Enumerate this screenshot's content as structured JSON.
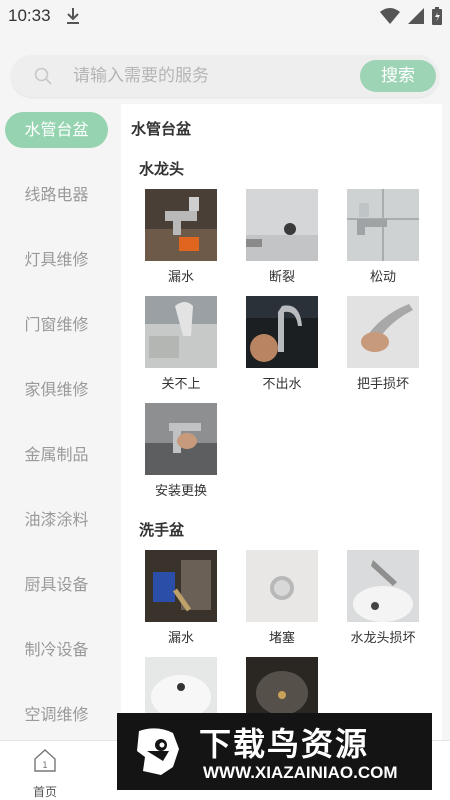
{
  "status_bar": {
    "time": "10:33",
    "icons": [
      "download-icon",
      "wifi-icon",
      "signal-icon",
      "battery-icon"
    ]
  },
  "search": {
    "placeholder": "请输入需要的服务",
    "button_label": "搜索"
  },
  "sidebar": {
    "items": [
      {
        "label": "水管台盆",
        "active": true
      },
      {
        "label": "线路电器",
        "active": false
      },
      {
        "label": "灯具维修",
        "active": false
      },
      {
        "label": "门窗维修",
        "active": false
      },
      {
        "label": "家俱维修",
        "active": false
      },
      {
        "label": "金属制品",
        "active": false
      },
      {
        "label": "油漆涂料",
        "active": false
      },
      {
        "label": "厨具设备",
        "active": false
      },
      {
        "label": "制冷设备",
        "active": false
      },
      {
        "label": "空调维修",
        "active": false
      }
    ]
  },
  "main": {
    "title": "水管台盆",
    "sections": [
      {
        "title": "水龙头",
        "items": [
          {
            "label": "漏水"
          },
          {
            "label": "断裂"
          },
          {
            "label": "松动"
          },
          {
            "label": "关不上"
          },
          {
            "label": "不出水"
          },
          {
            "label": "把手损坏"
          },
          {
            "label": "安装更换"
          }
        ]
      },
      {
        "title": "洗手盆",
        "items": [
          {
            "label": "漏水"
          },
          {
            "label": "堵塞"
          },
          {
            "label": "水龙头损坏"
          },
          {
            "label": ""
          },
          {
            "label": ""
          }
        ]
      }
    ]
  },
  "bottom_nav": {
    "items": [
      {
        "label": "首页",
        "icon": "home-icon"
      }
    ]
  },
  "watermark": {
    "title": "下载鸟资源",
    "url": "WWW.XIAZAINIAO.COM"
  },
  "colors": {
    "accent": "#96d4b1",
    "search_button": "#9ed4b6",
    "sidebar_text": "#9a9a9a"
  }
}
